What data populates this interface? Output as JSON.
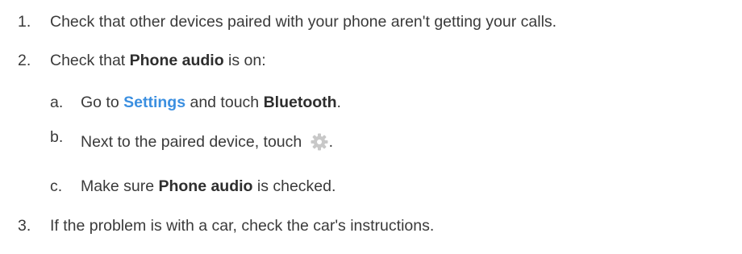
{
  "steps": [
    {
      "number": "1.",
      "text": "Check that other devices paired with your phone aren't getting your calls."
    },
    {
      "number": "2.",
      "text_before": "Check that ",
      "bold": "Phone audio",
      "text_after": " is on:",
      "substeps": [
        {
          "letter": "a.",
          "text_before": "Go to ",
          "link": "Settings",
          "text_mid": " and touch ",
          "bold": "Bluetooth",
          "text_after": "."
        },
        {
          "letter": "b.",
          "text_before": "Next to the paired device, touch ",
          "icon": "gear-icon",
          "text_after": "."
        },
        {
          "letter": "c.",
          "text_before": "Make sure ",
          "bold": "Phone audio",
          "text_after": " is checked."
        }
      ]
    },
    {
      "number": "3.",
      "text": "If the problem is with a car, check the car's instructions."
    }
  ],
  "colors": {
    "text": "#3a3a3a",
    "link": "#3b8fe0",
    "icon": "#c8c8c8"
  }
}
